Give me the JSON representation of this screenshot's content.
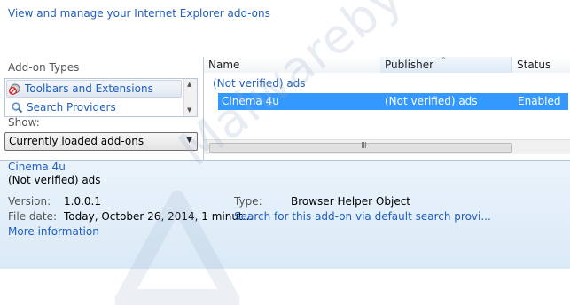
{
  "header": {
    "title_link": "View and manage your Internet Explorer add-ons"
  },
  "left": {
    "addon_types_label": "Add-on Types",
    "types": [
      {
        "label": "Toolbars and Extensions",
        "icon": "gear-blocked-icon",
        "selected": true
      },
      {
        "label": "Search Providers",
        "icon": "search-icon",
        "selected": false
      }
    ],
    "show_label": "Show:",
    "show_value": "Currently loaded add-ons"
  },
  "list": {
    "columns": [
      "Name",
      "Publisher",
      "Status"
    ],
    "group": "(Not verified) ads",
    "rows": [
      {
        "name": "Cinema 4u",
        "publisher": "(Not verified) ads",
        "status": "Enabled",
        "selected": true
      }
    ]
  },
  "details": {
    "name": "Cinema 4u",
    "publisher": "(Not verified) ads",
    "version_label": "Version:",
    "version_value": "1.0.0.1",
    "filedate_label": "File date:",
    "filedate_value": "Today, October 26, 2014, 1 minut...",
    "type_label": "Type:",
    "type_value": "Browser Helper Object",
    "search_link": "Search for this add-on via default search provi...",
    "more_info": "More information"
  },
  "watermark": {
    "text": "Malwarebytes"
  },
  "colors": {
    "link": "#1f5fbf",
    "selection": "#3399ff",
    "details_bg": "#e2eef9"
  }
}
